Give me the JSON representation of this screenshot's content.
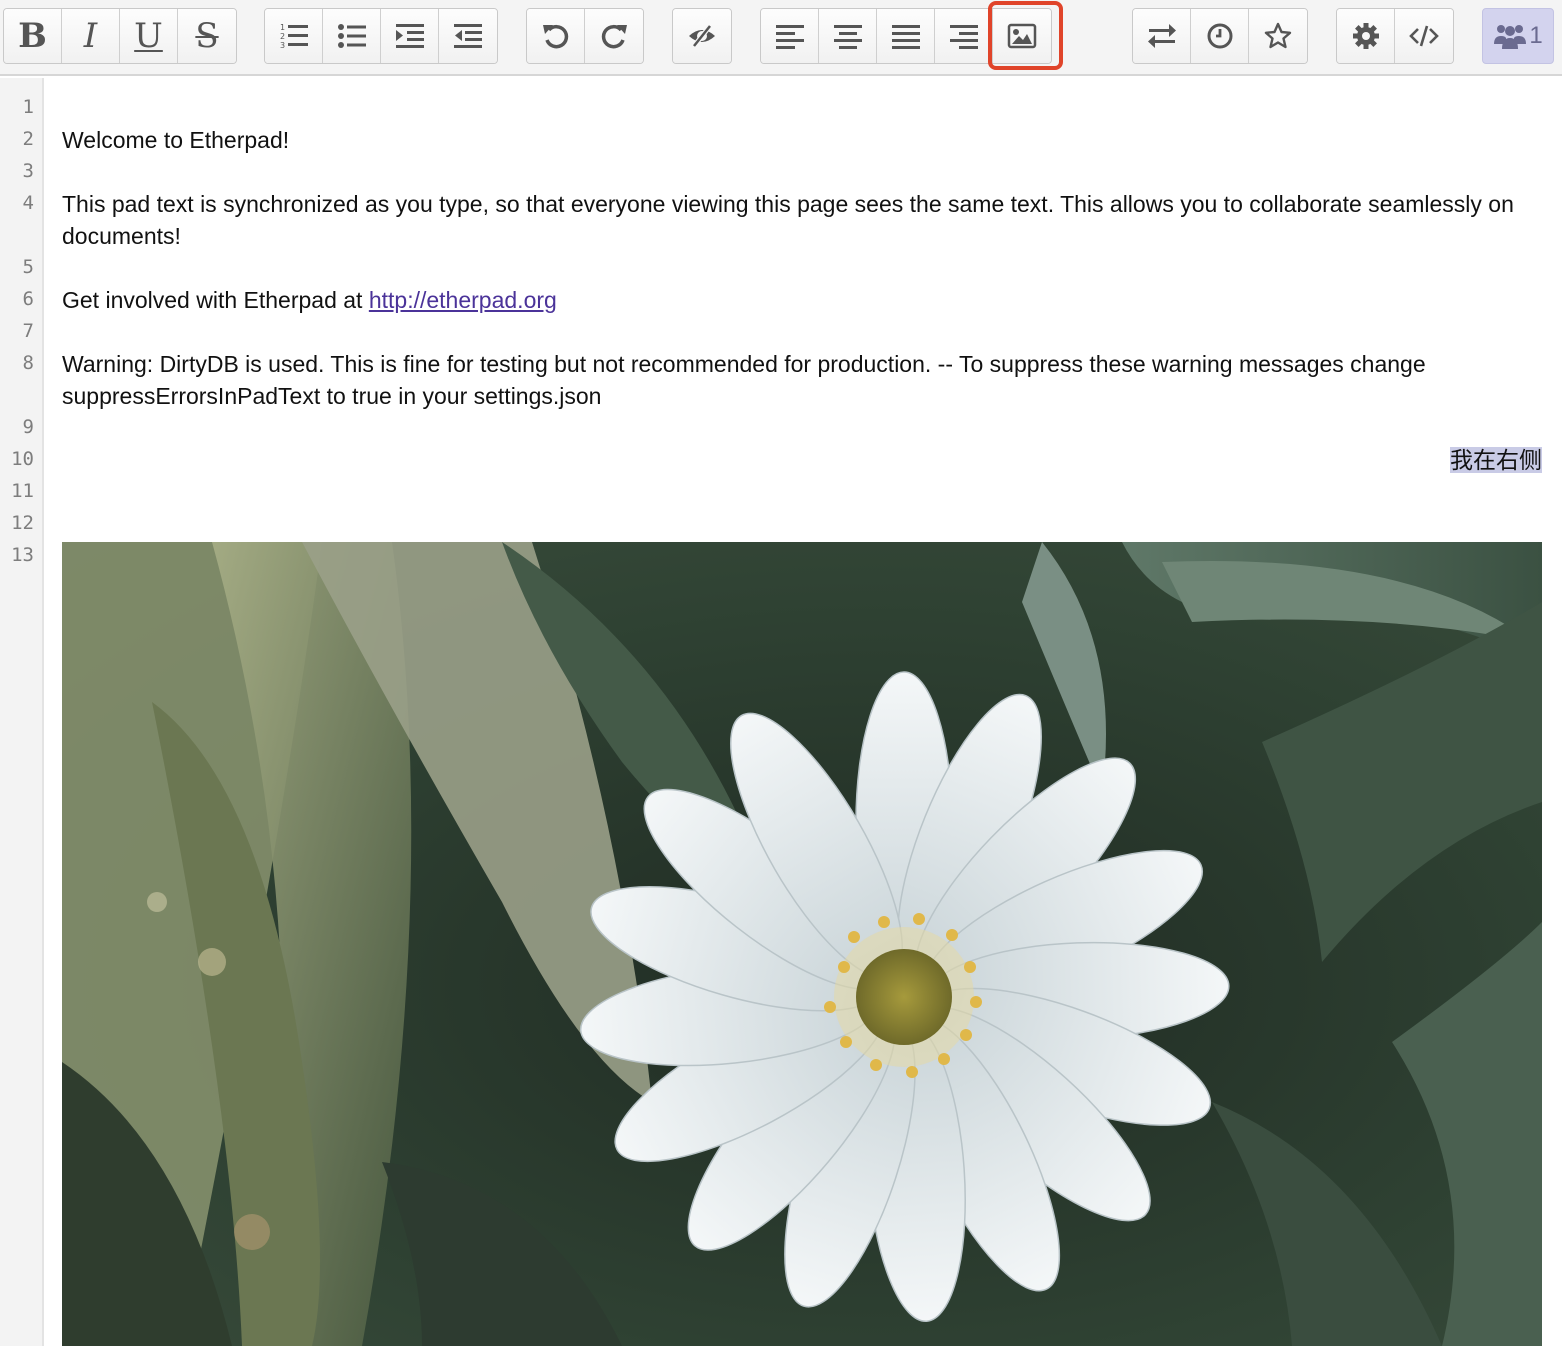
{
  "app": "Etherpad",
  "toolbar": {
    "format": [
      "B",
      "I",
      "U",
      "S"
    ],
    "lists_icons": [
      "ordered-list-icon",
      "unordered-list-icon",
      "indent-icon",
      "outdent-icon"
    ],
    "history_icons": [
      "undo-icon",
      "redo-icon"
    ],
    "view_icons": [
      "eye-slash-icon"
    ],
    "align_icons": [
      "align-left-icon",
      "align-center-icon",
      "align-justify-icon",
      "align-right-icon",
      "image-icon"
    ],
    "right_icons": [
      "import-export-icon",
      "timeslider-icon",
      "star-icon",
      "settings-icon",
      "embed-icon"
    ],
    "highlighted_button": "insert-image-button",
    "highlight_color": "#e0442a",
    "user_count": "1"
  },
  "lines": {
    "numbers": [
      "1",
      "2",
      "3",
      "4",
      "5",
      "6",
      "7",
      "8",
      "9",
      "10",
      "11",
      "12",
      "13"
    ]
  },
  "content": {
    "welcome": "Welcome to Etherpad!",
    "sync_text": "This pad text is synchronized as you type, so that everyone viewing this page sees the same text. This allows you to collaborate seamlessly on documents!",
    "involved_prefix": "Get involved with Etherpad at ",
    "involved_link": "http://etherpad.org",
    "warning": "Warning: DirtyDB is used. This is fine for testing but not recommended for production. -- To suppress these warning messages change suppressErrorsInPadText to true in your settings.json",
    "right_aligned": "我在右侧"
  },
  "colors": {
    "link": "#4b3399",
    "selection": "#c9cbe6",
    "users_button": "#d3d3ee"
  }
}
